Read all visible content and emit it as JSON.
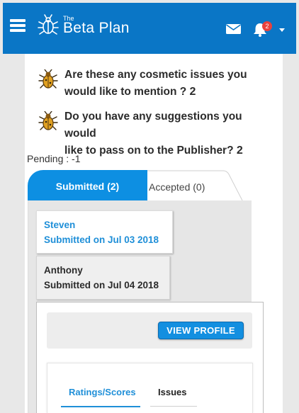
{
  "header": {
    "brand_prefix": "The",
    "brand_name": "Beta Plan",
    "notifications_count": "2",
    "icons": [
      "menu-icon",
      "bug-logo-icon",
      "mail-icon",
      "bell-icon",
      "chevron-down-icon"
    ],
    "color": "#0a76c6"
  },
  "questions": [
    {
      "line1": "Are these any cosmetic issues you",
      "line2": "would like to mention ?",
      "count": "2"
    },
    {
      "line1": "Do you have any suggestions you would",
      "line2": "like to pass on to the Publisher?",
      "count": "2"
    }
  ],
  "pending": "Pending : -1",
  "tabs": {
    "submitted": "Submitted (2)",
    "accepted": "Accepted (0)",
    "active": "submitted",
    "accent": "#0d8fe2"
  },
  "submissions": [
    {
      "name": "Steven",
      "date": "Submitted on Jul 03 2018",
      "selected": true
    },
    {
      "name": "Anthony",
      "date": "Submitted on Jul 04 2018",
      "selected": false
    }
  ],
  "detail": {
    "view_profile": "VIEW PROFILE",
    "subtabs": [
      "Ratings/Scores",
      "Issues"
    ],
    "active_subtab": "Ratings/Scores"
  }
}
